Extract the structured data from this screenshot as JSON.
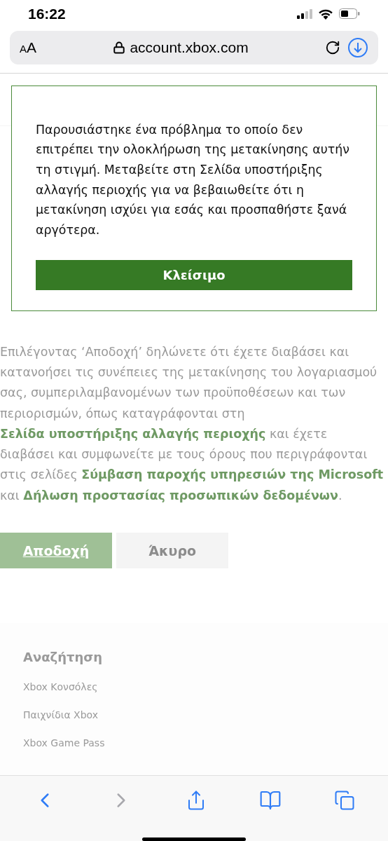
{
  "status_bar": {
    "time": "16:22"
  },
  "address_bar": {
    "text_size_button": "AA",
    "url": "account.xbox.com"
  },
  "page": {
    "consent_text": [
      {
        "text": "Επιλέγοντας ‘Αποδοχή’ δηλώνετε ότι έχετε διαβάσει και κατανοήσει τις συνέπειες της μετακίνησης του λογαριασμού σας, συμπεριλαμβανομένων των προϋποθέσεων και των περιορισμών, όπως καταγράφονται στη ",
        "link": false
      },
      {
        "text": "Σελίδα υποστήριξης αλλαγής περιοχής",
        "link": true
      },
      {
        "text": " και έχετε διαβάσει και συμφωνείτε με τους όρους που περιγράφονται στις σελίδες ",
        "link": false
      },
      {
        "text": "Σύμβαση παροχής υπηρεσιών της Microsoft",
        "link": true
      },
      {
        "text": " και ",
        "link": false
      },
      {
        "text": "Δήλωση προστασίας προσωπικών δεδομένων",
        "link": true
      },
      {
        "text": ".",
        "link": false
      }
    ],
    "buttons": [
      {
        "label": "Αποδοχή",
        "kind": "primary"
      },
      {
        "label": "Άκυρο",
        "kind": "secondary"
      }
    ],
    "footer": {
      "heading": "Αναζήτηση",
      "links": [
        "Xbox Κονσόλες",
        "Παιχνίδια Xbox",
        "Xbox Game Pass"
      ]
    }
  },
  "dialog": {
    "message": "Παρουσιάστηκε ένα πρόβλημα το οποίο δεν επιτρέπει την ολοκλήρωση της μετακίνησης αυτήν τη στιγμή. Μεταβείτε στη Σελίδα υποστήριξης αλλαγής περιοχής για να βεβαιωθείτε ότι η μετακίνηση ισχύει για εσάς και προσπαθήστε ξανά αργότερα.",
    "button": "Κλείσιμο"
  },
  "toolbar": [
    {
      "kind": "back",
      "disabled": false
    },
    {
      "kind": "forward",
      "disabled": true
    },
    {
      "kind": "share",
      "disabled": false
    },
    {
      "kind": "bookmarks",
      "disabled": false
    },
    {
      "kind": "tabs",
      "disabled": false
    }
  ]
}
